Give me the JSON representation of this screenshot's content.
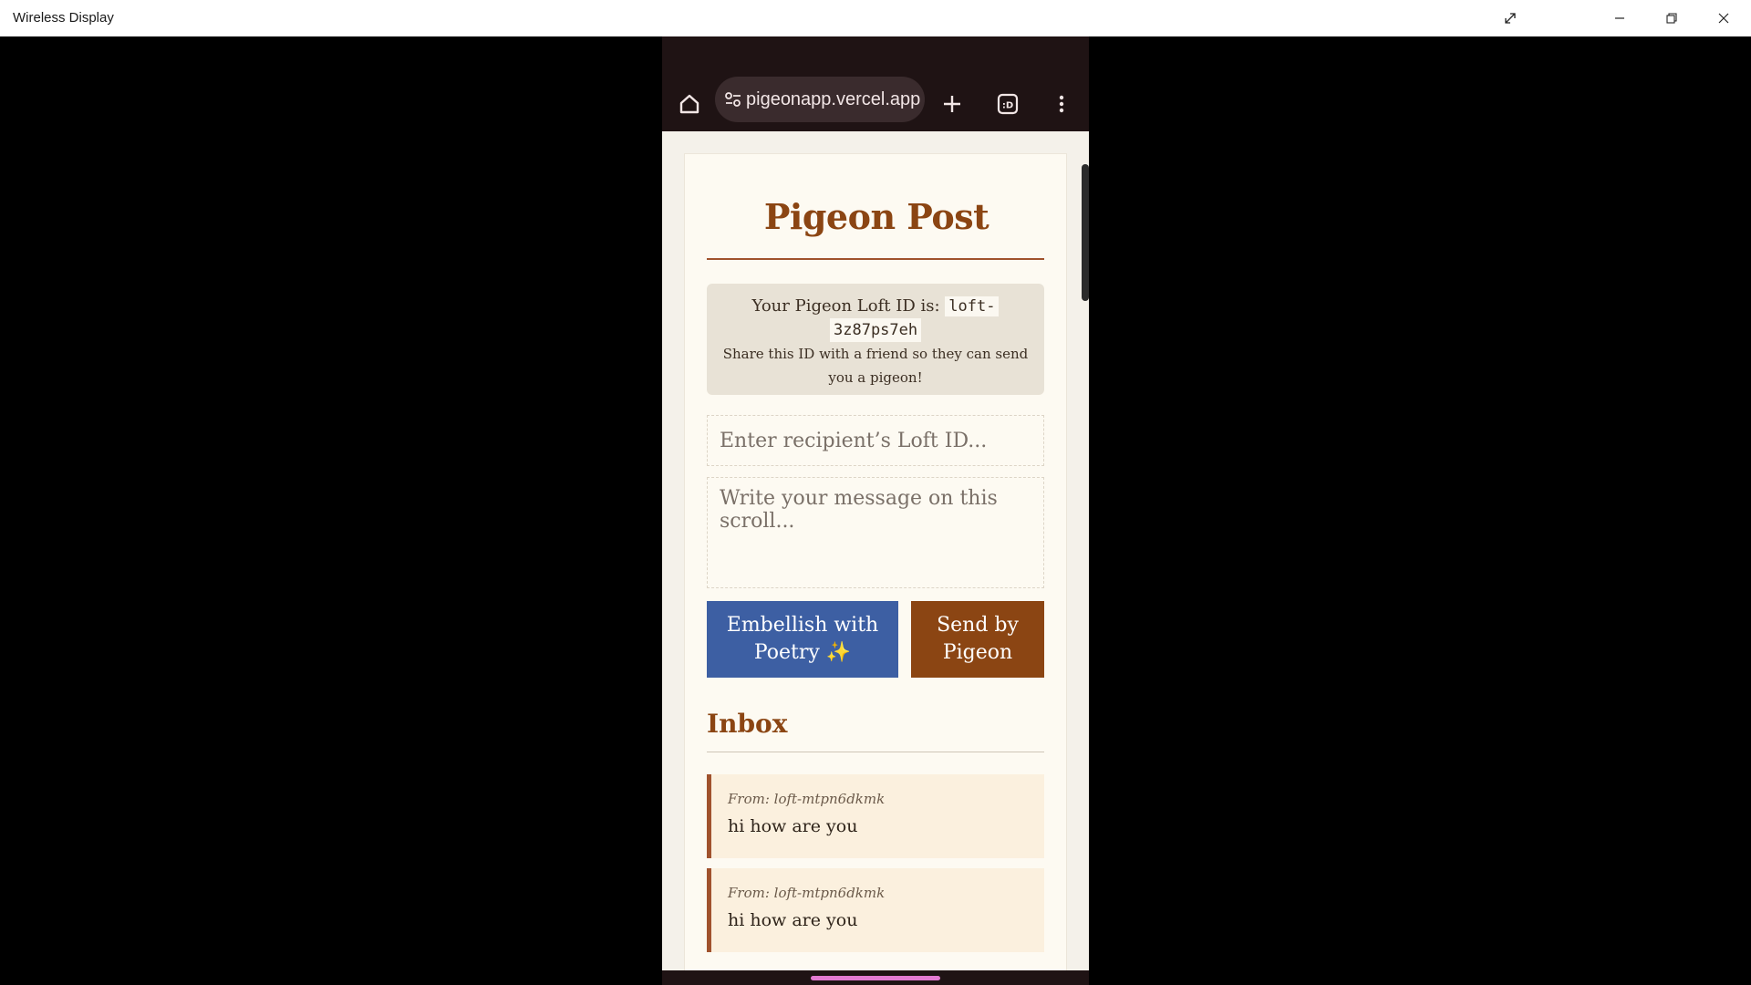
{
  "window": {
    "title": "Wireless Display"
  },
  "browser": {
    "url": "pigeonapp.vercel.app",
    "tab_count": ":D",
    "icons": [
      "home-icon",
      "site-settings-icon",
      "new-tab-icon",
      "tab-switcher-icon",
      "more-menu-icon"
    ]
  },
  "app": {
    "title": "Pigeon Post",
    "loft": {
      "prefix": "Your Pigeon Loft ID is:",
      "id_part1": "loft-",
      "id_part2": "3z87ps7eh",
      "share_text": "Share this ID with a friend so they can send you a pigeon!"
    },
    "recipient_placeholder": "Enter recipient’s Loft ID...",
    "message_placeholder": "Write your message on this scroll...",
    "poetry_button": "Embellish with Poetry ✨",
    "send_button": "Send by Pigeon",
    "inbox_title": "Inbox",
    "messages": [
      {
        "from": "From: loft-mtpn6dkmk",
        "body": "hi how are you"
      },
      {
        "from": "From: loft-mtpn6dkmk",
        "body": "hi how are you"
      }
    ]
  },
  "colors": {
    "accent": "#8b4513",
    "poetry_button": "#3d5fa3",
    "gesture_bar": "#e37ad1"
  }
}
